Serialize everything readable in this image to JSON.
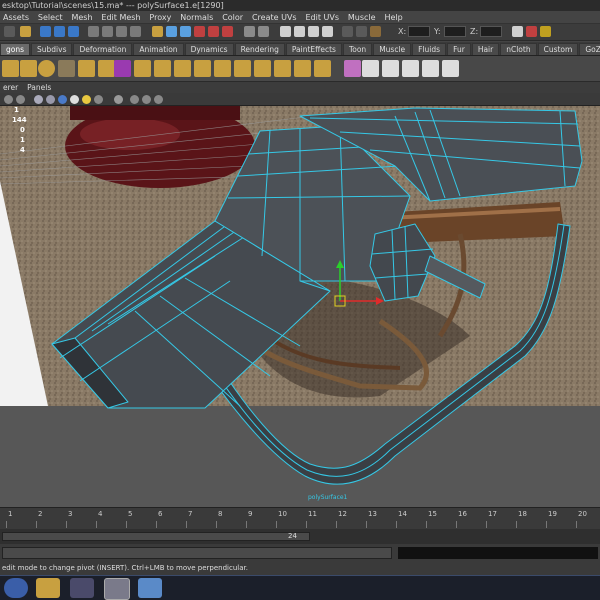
{
  "window": {
    "title": "esktop\\Tutorial\\scenes\\15.ma*   ---   polySurface1.e[1290]"
  },
  "menubar": {
    "items": [
      "Assets",
      "Select",
      "Mesh",
      "Edit Mesh",
      "Proxy",
      "Normals",
      "Color",
      "Create UVs",
      "Edit UVs",
      "Muscle",
      "Help"
    ]
  },
  "status_line": {
    "x_label": "X:",
    "y_label": "Y:",
    "z_label": "Z:"
  },
  "shelf": {
    "tabs": [
      "gons",
      "Subdivs",
      "Deformation",
      "Animation",
      "Dynamics",
      "Rendering",
      "PaintEffects",
      "Toon",
      "Muscle",
      "Fluids",
      "Fur",
      "Hair",
      "nCloth",
      "Custom",
      "GoZBrush"
    ],
    "active_tab": "gons"
  },
  "panel_menu": {
    "items": [
      "erer",
      "Panels"
    ]
  },
  "hud": {
    "values": [
      "1",
      "144",
      "0",
      "1",
      "4"
    ]
  },
  "manipulator": {
    "label": ""
  },
  "model_label": "polySurface1",
  "timeline": {
    "ticks": [
      "1",
      "2",
      "3",
      "4",
      "5",
      "6",
      "7",
      "8",
      "9",
      "10",
      "11",
      "12",
      "13",
      "14",
      "15",
      "16",
      "17",
      "18",
      "19",
      "20"
    ],
    "current_frame": "24"
  },
  "help_line": "edit mode to change pivot (INSERT). Ctrl+LMB to move perpendicular.",
  "taskbar": {
    "apps": [
      "start-orb-icon",
      "explorer-icon",
      "media-player-icon",
      "maya-icon",
      "paint-icon"
    ]
  },
  "colors": {
    "wireframe": "#35c8e6",
    "mesh": "#3f4449",
    "selection": "#6be0ff"
  }
}
